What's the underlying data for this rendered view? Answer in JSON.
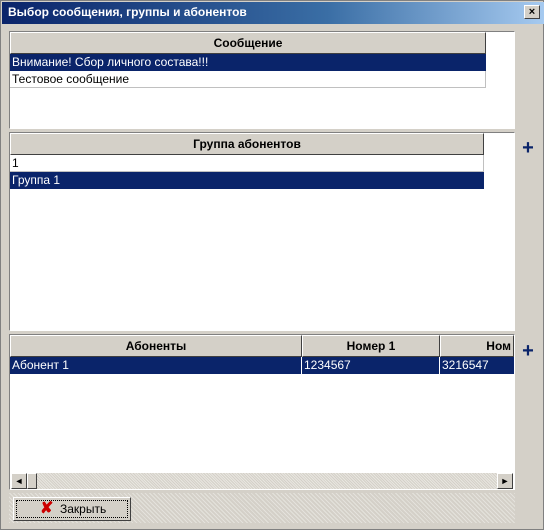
{
  "window": {
    "title": "Выбор сообщения, группы и абонентов",
    "close_glyph": "×"
  },
  "messages": {
    "header": "Сообщение",
    "rows": [
      "Внимание! Сбор личного состава!!!",
      "Тестовое сообщение"
    ],
    "selected_index": 0
  },
  "groups": {
    "header": "Группа абонентов",
    "rows": [
      "1",
      "Группа 1"
    ],
    "selected_index": 1,
    "add_glyph": "+"
  },
  "subscribers": {
    "columns": [
      "Абоненты",
      "Номер 1",
      "Ном"
    ],
    "rows": [
      [
        "Абонент 1",
        "1234567",
        "3216547"
      ]
    ],
    "selected_index": 0,
    "add_glyph": "+",
    "scroll_left_glyph": "◄",
    "scroll_right_glyph": "►"
  },
  "footer": {
    "close_label": "Закрыть",
    "close_icon_glyph": "✘"
  },
  "colors": {
    "selection": "#0a246a",
    "title_start": "#0a246a",
    "title_end": "#a6caf0",
    "close_icon": "#cc0000",
    "plus": "#0a246a"
  }
}
